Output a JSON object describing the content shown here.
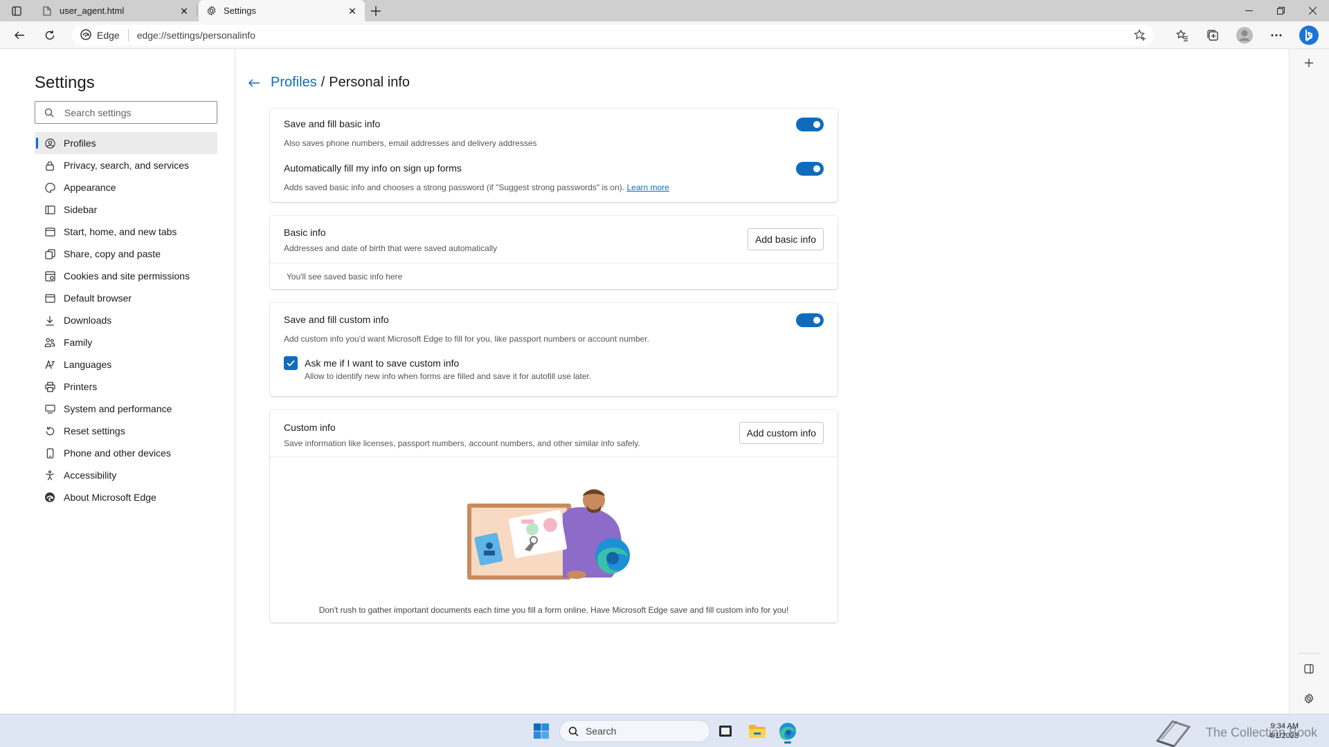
{
  "tabs": [
    {
      "title": "user_agent.html"
    },
    {
      "title": "Settings"
    }
  ],
  "toolbar": {
    "site_label": "Edge",
    "url": "edge://settings/personalinfo"
  },
  "nav": {
    "title": "Settings",
    "search_placeholder": "Search settings",
    "items": [
      {
        "label": "Profiles",
        "icon": "profile-icon",
        "active": true
      },
      {
        "label": "Privacy, search, and services",
        "icon": "lock-icon"
      },
      {
        "label": "Appearance",
        "icon": "appearance-icon"
      },
      {
        "label": "Sidebar",
        "icon": "sidebar-icon"
      },
      {
        "label": "Start, home, and new tabs",
        "icon": "home-icon"
      },
      {
        "label": "Share, copy and paste",
        "icon": "share-icon"
      },
      {
        "label": "Cookies and site permissions",
        "icon": "cookie-icon"
      },
      {
        "label": "Default browser",
        "icon": "browser-icon"
      },
      {
        "label": "Downloads",
        "icon": "download-icon"
      },
      {
        "label": "Family",
        "icon": "family-icon"
      },
      {
        "label": "Languages",
        "icon": "language-icon"
      },
      {
        "label": "Printers",
        "icon": "printer-icon"
      },
      {
        "label": "System and performance",
        "icon": "system-icon"
      },
      {
        "label": "Reset settings",
        "icon": "reset-icon"
      },
      {
        "label": "Phone and other devices",
        "icon": "phone-icon"
      },
      {
        "label": "Accessibility",
        "icon": "accessibility-icon"
      },
      {
        "label": "About Microsoft Edge",
        "icon": "edge-icon"
      }
    ]
  },
  "breadcrumb": {
    "parent": "Profiles",
    "separator": "/",
    "current": "Personal info"
  },
  "card1": {
    "save_fill_title": "Save and fill basic info",
    "save_fill_sub": "Also saves phone numbers, email addresses and delivery addresses",
    "auto_fill_title": "Automatically fill my info on sign up forms",
    "auto_fill_sub": "Adds saved basic info and chooses a strong password (if \"Suggest strong passwords\" is on).",
    "learn_more": "Learn more",
    "save_fill_on": true,
    "auto_fill_on": true
  },
  "card2": {
    "title": "Basic info",
    "sub": "Addresses and date of birth that were saved automatically",
    "button": "Add basic info",
    "empty": "You'll see saved basic info here"
  },
  "card3": {
    "title": "Save and fill custom info",
    "sub": "Add custom info you'd want Microsoft Edge to fill for you, like passport numbers or account number.",
    "toggle_on": true,
    "checkbox_label": "Ask me if I want to save custom info",
    "checkbox_sub": "Allow to identify new info when forms are filled and save it for autofill use later.",
    "checkbox_checked": true
  },
  "card4": {
    "title": "Custom info",
    "sub": "Save information like licenses, passport numbers, account numbers, and other similar info safely.",
    "button": "Add custom info",
    "footer": "Don't rush to gather important documents each time you fill a form online. Have Microsoft Edge save and fill custom info for you!"
  },
  "taskbar": {
    "search": "Search",
    "time": "9:34 AM",
    "date": "4/1/2023",
    "watermark": "The Collection Book"
  },
  "colors": {
    "accent": "#0f6cbd",
    "tabstrip": "#cfcfcf",
    "taskbar": "#dde6f2"
  }
}
